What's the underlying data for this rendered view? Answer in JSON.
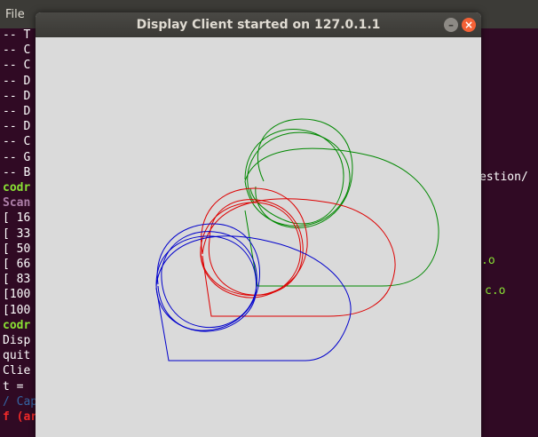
{
  "terminal": {
    "menu": {
      "file": "File",
      "hint": ""
    },
    "left_lines": [
      {
        "text": "-- T",
        "cls": "white"
      },
      {
        "text": "-- C",
        "cls": "white"
      },
      {
        "text": "-- C",
        "cls": "white"
      },
      {
        "text": "-- D",
        "cls": "white"
      },
      {
        "text": "-- D",
        "cls": "white"
      },
      {
        "text": "-- D",
        "cls": "white"
      },
      {
        "text": "-- D",
        "cls": "white"
      },
      {
        "text": "-- C",
        "cls": "white"
      },
      {
        "text": "-- G",
        "cls": "white"
      },
      {
        "text": "-- B",
        "cls": "white"
      },
      {
        "text": "codr",
        "cls": "green"
      },
      {
        "text": "Scan",
        "cls": "magenta"
      },
      {
        "text": "[ 16",
        "cls": "white"
      },
      {
        "text": "[ 33",
        "cls": "white"
      },
      {
        "text": "[ 50",
        "cls": "white"
      },
      {
        "text": "[ 66",
        "cls": "white"
      },
      {
        "text": "[ 83",
        "cls": "white"
      },
      {
        "text": "[100",
        "cls": "white"
      },
      {
        "text": "[100",
        "cls": "white"
      },
      {
        "text": "codr",
        "cls": "green"
      },
      {
        "text": "Disp",
        "cls": "white"
      },
      {
        "text": "quit",
        "cls": "white"
      },
      {
        "text": "Clie",
        "cls": "white"
      },
      {
        "text": "t =",
        "cls": "white"
      },
      {
        "text": "/ Cap",
        "cls": "blue"
      },
      {
        "text": "f (ar",
        "cls": "red"
      }
    ],
    "right_fragments": {
      "estion": "estion/",
      "dot_o_1": ".o",
      "dot_o_2": "c.o"
    }
  },
  "window": {
    "title": "Display Client started on 127.0.1.1",
    "minimize_glyph": "–",
    "close_glyph": "×",
    "colors": {
      "blue": "#0000cc",
      "red": "#dd0000",
      "green": "#008800"
    }
  }
}
